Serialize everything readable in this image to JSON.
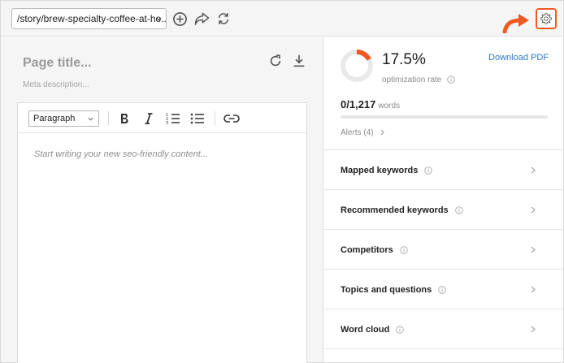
{
  "toolbar": {
    "url_value": "/story/brew-specialty-coffee-at-ho...",
    "add_icon": "plus-circle-icon",
    "share_icon": "share-arrow-icon",
    "sync_icon": "sync-icon",
    "settings_icon": "gear-icon"
  },
  "editor": {
    "page_title_placeholder": "Page title...",
    "meta_description_placeholder": "Meta description...",
    "format_select_value": "Paragraph",
    "content_placeholder": "Start writing your new seo-friendly content..."
  },
  "stats": {
    "optimization_rate": "17.5%",
    "optimization_rate_fraction": 0.175,
    "optimization_label": "optimization rate",
    "download_pdf_label": "Download PDF",
    "word_count": "0",
    "word_target": "/1,217",
    "words_unit": "words",
    "word_progress_fraction": 0,
    "alerts_label": "Alerts (4)"
  },
  "sections": [
    {
      "label": "Mapped keywords"
    },
    {
      "label": "Recommended keywords"
    },
    {
      "label": "Competitors"
    },
    {
      "label": "Topics and questions"
    },
    {
      "label": "Word cloud"
    }
  ],
  "colors": {
    "accent": "#f05a22",
    "link": "#2f79c2",
    "toolbar_bg": "#f5f5f5",
    "border": "#dcdcdc"
  }
}
